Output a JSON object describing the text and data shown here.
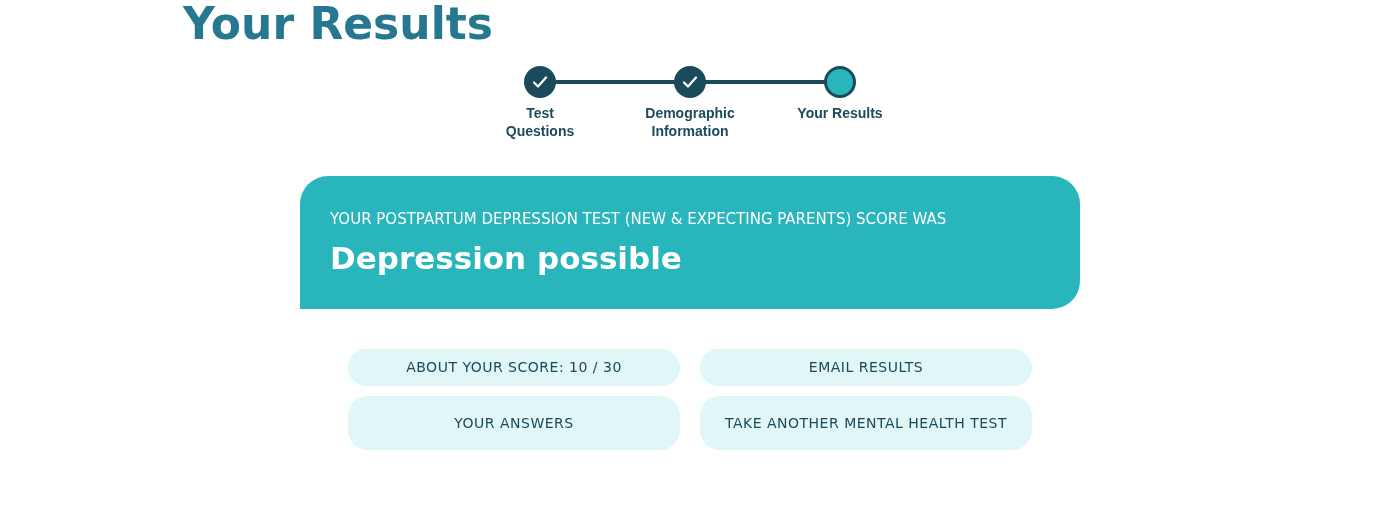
{
  "page_title": "Your Results",
  "steps": [
    {
      "label": "Test Questions",
      "completed": true
    },
    {
      "label": "Demographic Information",
      "completed": true
    },
    {
      "label": "Your Results",
      "completed": false
    }
  ],
  "result": {
    "caption": "YOUR POSTPARTUM DEPRESSION TEST (NEW & EXPECTING PARENTS) SCORE WAS",
    "outcome": "Depression possible"
  },
  "actions": [
    {
      "label": "ABOUT YOUR SCORE: 10 / 30"
    },
    {
      "label": "EMAIL RESULTS"
    },
    {
      "label": "YOUR ANSWERS"
    },
    {
      "label": "TAKE ANOTHER MENTAL HEALTH TEST"
    }
  ]
}
